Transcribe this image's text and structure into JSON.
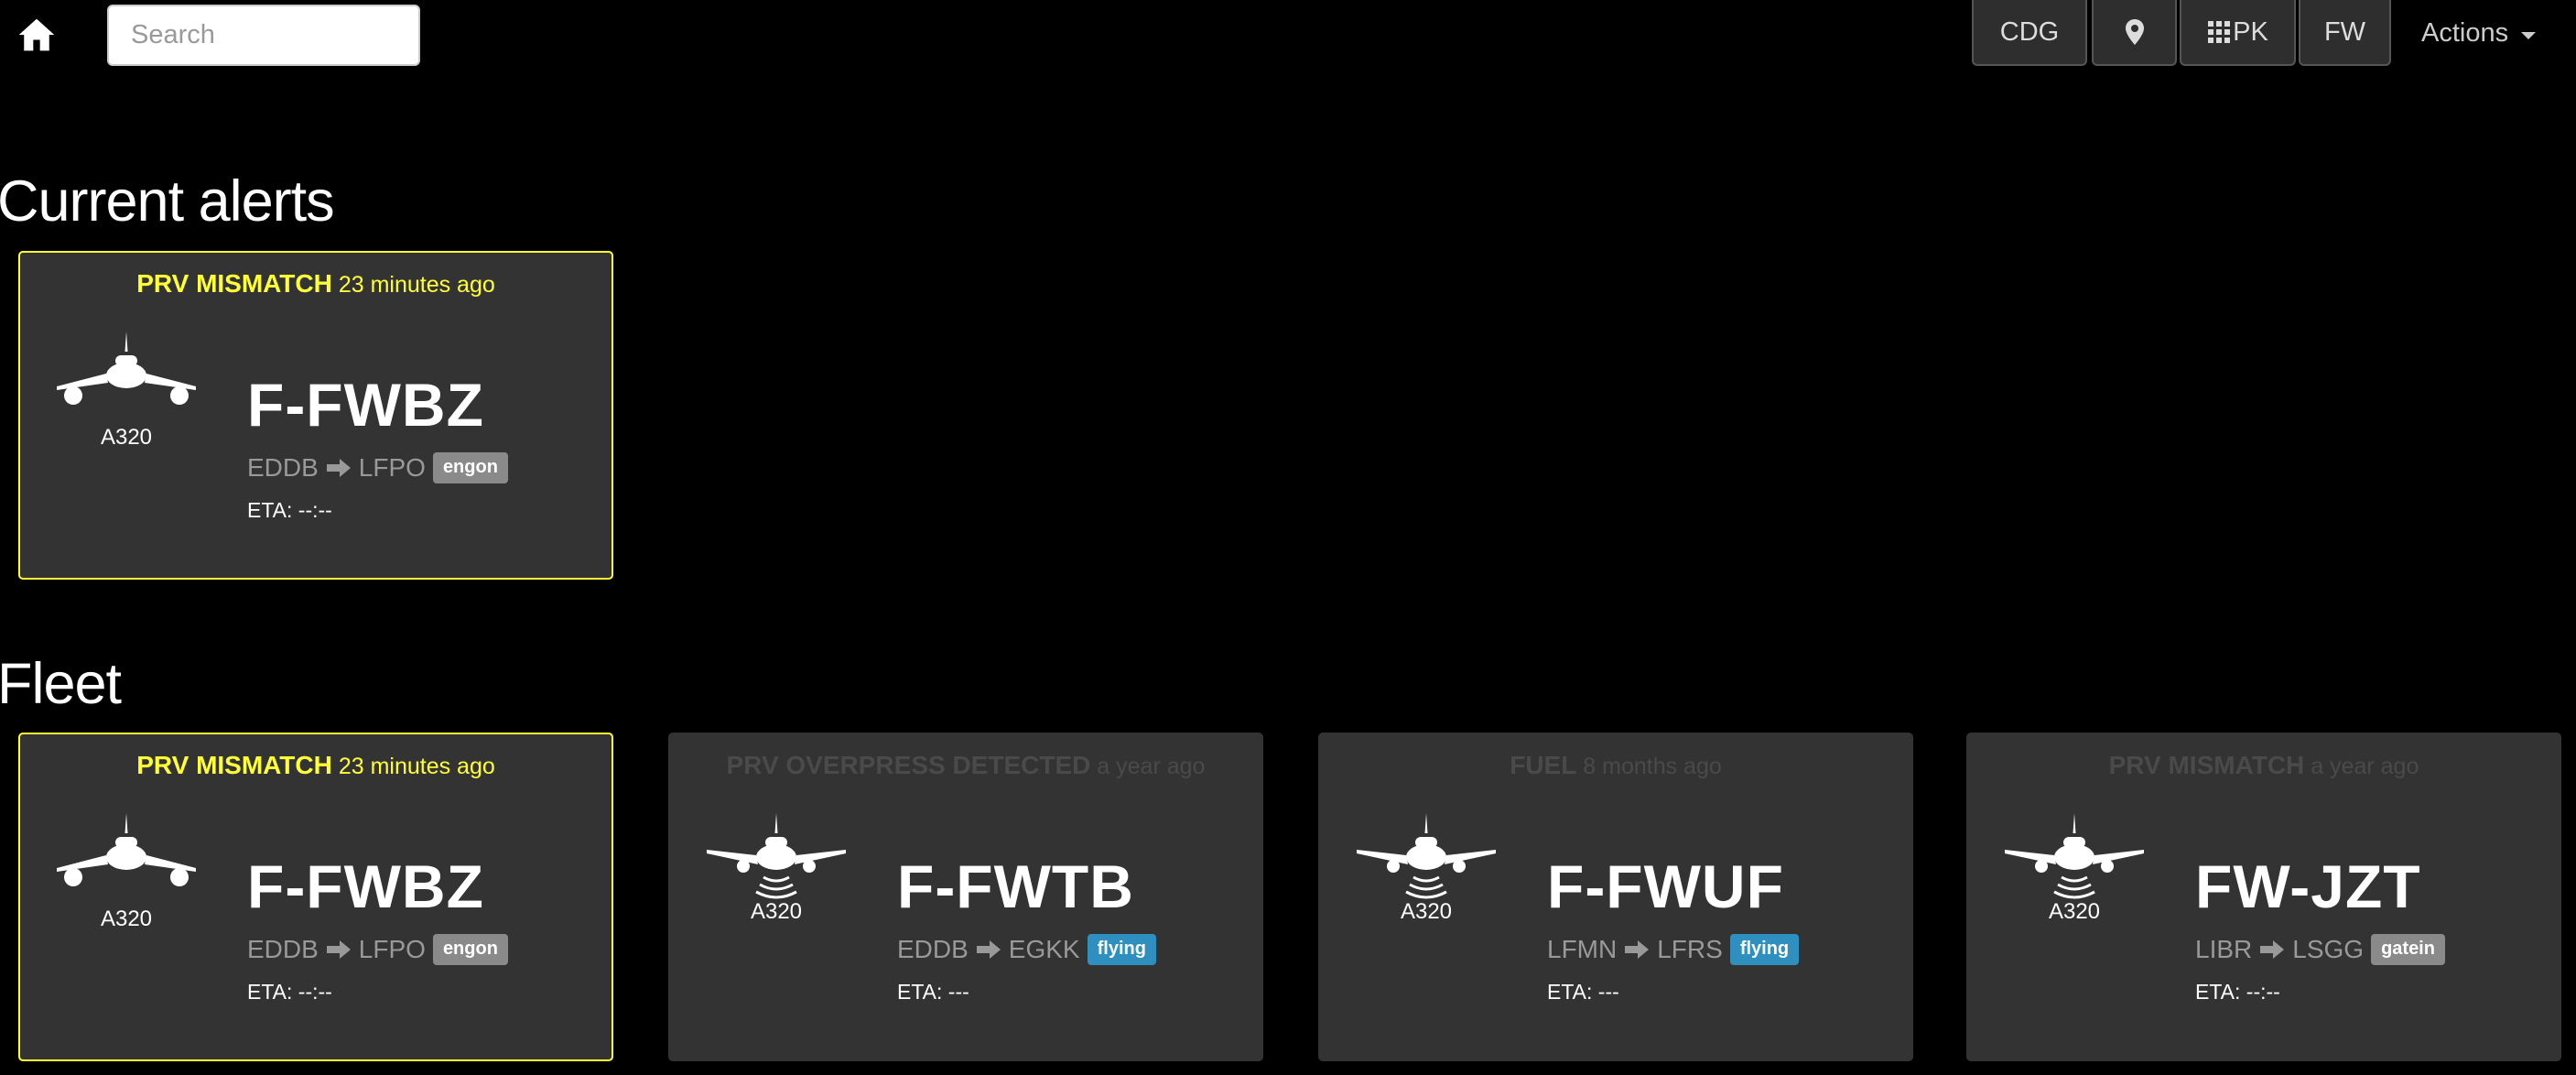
{
  "header": {
    "search_placeholder": "Search",
    "buttons": {
      "cdg": "CDG",
      "pk": "PK",
      "fw": "FW"
    },
    "actions_label": "Actions",
    "icons": {
      "home": "home-icon",
      "pin": "map-pin-icon",
      "grid": "grid-icon"
    }
  },
  "sections": {
    "alerts_title": "Current alerts",
    "fleet_title": "Fleet"
  },
  "alerts": [
    {
      "alert": "PRV MISMATCH",
      "time": "23 minutes ago",
      "type": "A320",
      "reg": "F-FWBZ",
      "origin": "EDDB",
      "destination": "LFPO",
      "status": "engon",
      "eta": "ETA: --:--"
    }
  ],
  "fleet": [
    {
      "alert": "PRV MISMATCH",
      "time": "23 minutes ago",
      "type": "A320",
      "reg": "F-FWBZ",
      "origin": "EDDB",
      "destination": "LFPO",
      "status": "engon",
      "eta": "ETA: --:--"
    },
    {
      "alert": "PRV OVERPRESS DETECTED",
      "time": "a year ago",
      "type": "A320",
      "reg": "F-FWTB",
      "origin": "EDDB",
      "destination": "EGKK",
      "status": "flying",
      "eta": "ETA: ---"
    },
    {
      "alert": "FUEL",
      "time": "8 months ago",
      "type": "A320",
      "reg": "F-FWUF",
      "origin": "LFMN",
      "destination": "LFRS",
      "status": "flying",
      "eta": "ETA: ---"
    },
    {
      "alert": "PRV MISMATCH",
      "time": "a year ago",
      "type": "A320",
      "reg": "FW-JZT",
      "origin": "LIBR",
      "destination": "LSGG",
      "status": "gatein",
      "eta": "ETA: --:--"
    }
  ],
  "colors": {
    "background": "#000000",
    "card": "#333333",
    "alert_yellow": "#ffff33",
    "flying_badge": "#2f8fbf",
    "ground_badge": "#8a8a8a"
  }
}
